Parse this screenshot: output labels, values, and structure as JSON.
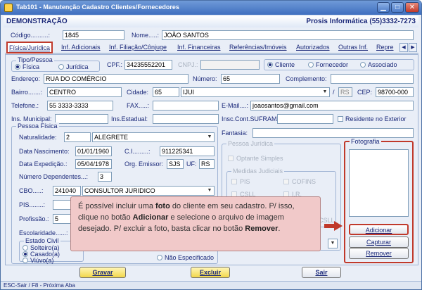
{
  "window": {
    "title": "Tab101 - Manutenção Cadastro Clientes/Fornecedores"
  },
  "header": {
    "left": "DEMONSTRAÇÃO",
    "right": "Prosis Informática (55)3332-7273"
  },
  "codigo": {
    "label": "Código..........:",
    "value": "1845"
  },
  "nome": {
    "label": "Nome.....:",
    "value": "JOÃO SANTOS"
  },
  "tabs": [
    {
      "label": "Física/Jurídica"
    },
    {
      "label": "Inf. Adicionais"
    },
    {
      "label": "Inf. Filiação/Cônjuge"
    },
    {
      "label": "Inf. Financeiras"
    },
    {
      "label": "Referências/Imóveis"
    },
    {
      "label": "Autorizados"
    },
    {
      "label": "Outras Inf."
    },
    {
      "label": "Repre"
    }
  ],
  "tipo_pessoa": {
    "title": "Tipo/Pessoa",
    "fisica": "Física",
    "juridica": "Jurídica"
  },
  "cpf": {
    "label": "CPF.:",
    "value": "34235552201"
  },
  "cnpj": {
    "label": "CNPJ.:",
    "value": ""
  },
  "tipo_cadastro": {
    "cliente": "Cliente",
    "fornecedor": "Fornecedor",
    "associado": "Associado"
  },
  "endereco": {
    "label": "Endereço:",
    "value": "RUA DO COMÉRCIO"
  },
  "numero": {
    "label": "Número:",
    "value": "65"
  },
  "complemento": {
    "label": "Complemento:",
    "value": ""
  },
  "bairro": {
    "label": "Bairro.......:",
    "value": "CENTRO"
  },
  "cidade": {
    "label": "Cidade:",
    "code": "65",
    "name": "IJUI",
    "uf": "RS"
  },
  "cep": {
    "label": "CEP:",
    "value": "98700-000"
  },
  "telefone": {
    "label": "Telefone.:",
    "value": "55 3333-3333"
  },
  "fax": {
    "label": "FAX.....:",
    "value": ""
  },
  "email": {
    "label": "E-Mail....:",
    "value": "joaosantos@gmail.com"
  },
  "ins_municipal": {
    "label": "Ins. Municipal:",
    "value": ""
  },
  "ins_estadual": {
    "label": "Ins.Estadual:",
    "value": ""
  },
  "insc_suframa": {
    "label": "Insc.Cont.SUFRAMA:",
    "value": ""
  },
  "residente_exterior": {
    "label": "Residente no Exterior"
  },
  "fantasia": {
    "label": "Fantasia:",
    "value": ""
  },
  "pessoa_fisica": {
    "title": "Pessoa Física",
    "naturalidade": {
      "label": "Naturalidade:",
      "code": "2",
      "name": "ALEGRETE"
    },
    "data_nascimento": {
      "label": "Data Nascimento:",
      "value": "01/01/1960"
    },
    "ci": {
      "label": "C.I.........:",
      "value": "911225341"
    },
    "data_expedicao": {
      "label": "Data Expedição.:",
      "value": "05/04/1978"
    },
    "org_emissor": {
      "label": "Org. Emissor:",
      "value": "SJS"
    },
    "uf": {
      "label": "UF:",
      "value": "RS"
    },
    "num_dependentes": {
      "label": "Número Dependentes...:",
      "value": "3"
    },
    "cbo": {
      "label": "CBO.....:",
      "code": "241040",
      "name": "CONSULTOR JURIDICO"
    },
    "pis": {
      "label": "PIS........:",
      "value": ""
    },
    "profissao": {
      "label": "Profissão.:",
      "value": "5"
    },
    "escolaridade": {
      "label": "Escolaridade......:"
    }
  },
  "estado_civil": {
    "title": "Estado Civil",
    "solteiro": "Solteiro(a)",
    "casado": "Casado(a)",
    "viuvo": "Viúvo(a)",
    "nao_especificado": "Não Especificado"
  },
  "pessoa_juridica": {
    "title": "Pessoa Jurídica",
    "optante_simples": "Optante Simples",
    "medidas_title": "Medidas Judiciais",
    "pis": "PIS",
    "cofins": "COFINS",
    "csll": "CSLL",
    "ir": "I.R.",
    "csll2": "CSLL"
  },
  "fotografia": {
    "title": "Fotografia",
    "adicionar": "Adicionar",
    "capturar": "Capturar",
    "remover": "Remover"
  },
  "buttons": {
    "gravar": "Gravar",
    "excluir": "Excluir",
    "sair": "Sair"
  },
  "status_bar": "ESC-Sair / F8 - Próxima Aba",
  "callout": {
    "t1": "É possível incluir uma ",
    "b1": "foto",
    "t2": " do cliente em seu cadastro. P/ isso, clique no botão ",
    "b2": "Adicionar",
    "t3": " e selecione o arquivo de imagem desejado. P/ excluir a foto, basta clicar no botão ",
    "b3": "Remover",
    "t4": "."
  },
  "colors": {
    "accent": "#c0392b",
    "callout_bg": "#f1c9c9",
    "text": "#1c2a7a"
  }
}
